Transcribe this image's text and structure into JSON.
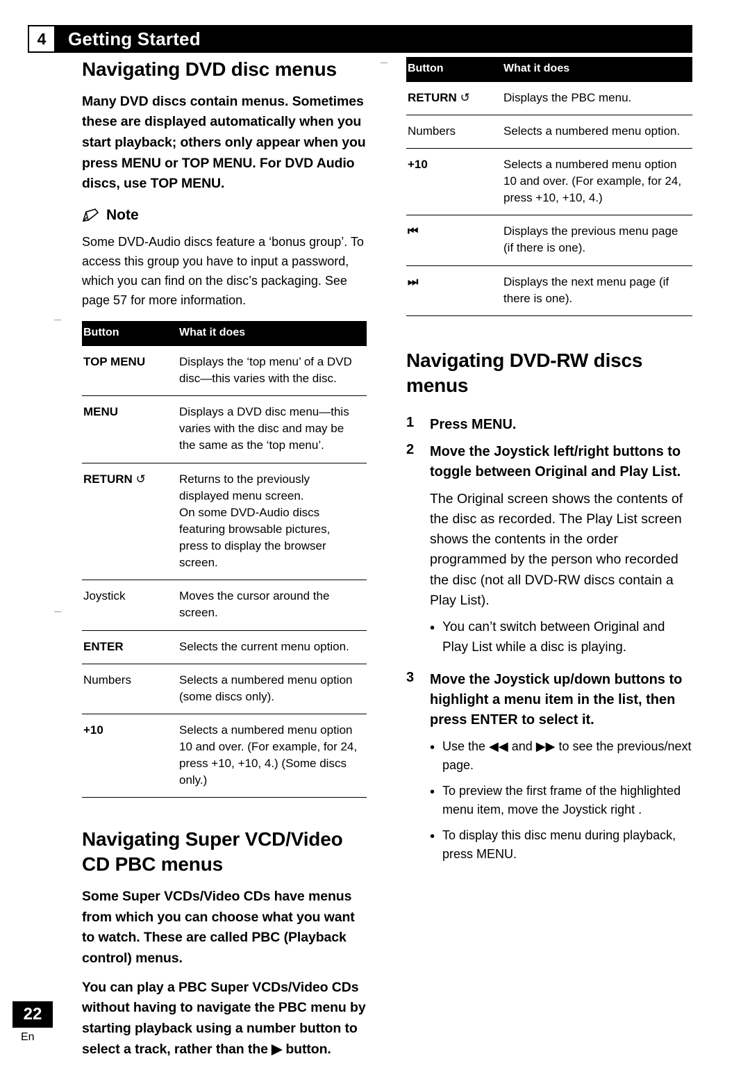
{
  "header": {
    "chapter_number": "4",
    "title": "Getting Started"
  },
  "page": {
    "number": "22",
    "language": "En"
  },
  "left": {
    "heading1": "Navigating DVD disc menus",
    "intro": "Many DVD discs contain menus. Sometimes these are displayed automatically when you start playback; others only appear when you press MENU or TOP MENU. For DVD Audio discs, use TOP MENU.",
    "note_label": "Note",
    "note_text": "Some DVD-Audio discs feature a ‘bonus group’. To access this group you have to input a password, which you can find on the disc’s packaging. See page 57 for more information.",
    "table": {
      "headers": [
        "Button",
        "What it does"
      ],
      "rows": [
        {
          "button": "TOP MENU",
          "bold": true,
          "what": "Displays the ‘top menu’ of a DVD disc—this varies with the disc."
        },
        {
          "button": "MENU",
          "bold": true,
          "what": "Displays a DVD disc menu—this varies with the disc and may be the same as the ‘top menu’."
        },
        {
          "button": "RETURN",
          "bold": true,
          "icon": "return-symbol",
          "what": "Returns to the previously displayed menu screen.\nOn some DVD-Audio discs featuring browsable pictures, press to display the browser screen."
        },
        {
          "button": "Joystick",
          "bold": false,
          "what": "Moves the cursor around the screen."
        },
        {
          "button": "ENTER",
          "bold": true,
          "what": "Selects the current menu option."
        },
        {
          "button": "Numbers",
          "bold": false,
          "what": "Selects a numbered menu option (some discs only)."
        },
        {
          "button": "+10",
          "bold": true,
          "what": "Selects a numbered menu option 10 and over. (For example, for 24, press +10, +10, 4.) (Some discs only.)"
        }
      ]
    },
    "heading2": "Navigating Super VCD/Video CD PBC menus",
    "para1": "Some Super VCDs/Video CDs have menus from which you can choose what you want to watch. These are called PBC (Playback control) menus.",
    "para2": "You can play a PBC Super VCDs/Video CDs without having to navigate the PBC menu by starting playback using a number button to select a track, rather than the ▶ button."
  },
  "right": {
    "table": {
      "headers": [
        "Button",
        "What it does"
      ],
      "rows": [
        {
          "button": "RETURN",
          "bold": true,
          "icon": "return-symbol",
          "what": "Displays the PBC menu."
        },
        {
          "button": "Numbers",
          "bold": false,
          "what": "Selects a numbered menu option."
        },
        {
          "button": "+10",
          "bold": true,
          "what": "Selects a numbered menu option 10 and over. (For example, for 24, press +10, +10, 4.)"
        },
        {
          "button": "◀◀",
          "bold": true,
          "icon": "prev-icon",
          "what": "Displays the previous menu page (if there is one)."
        },
        {
          "button": "▶▶",
          "bold": true,
          "icon": "next-icon",
          "what": "Displays the next menu page (if there is one)."
        }
      ]
    },
    "heading": "Navigating DVD-RW discs menus",
    "steps": [
      {
        "n": "1",
        "text": "Press MENU."
      },
      {
        "n": "2",
        "text": "Move the Joystick left/right buttons to toggle between Original and Play List."
      },
      {
        "n": "3",
        "text": "Move the Joystick up/down buttons to highlight a menu item in the list, then press ENTER to select it."
      }
    ],
    "step2_body": "The Original screen shows the contents of the disc as recorded. The Play List screen shows the contents in the order programmed by the person who recorded the disc (not all DVD-RW discs contain a Play List).",
    "step2_bullet": "You can’t switch between Original and Play List while a disc is playing.",
    "step3_bullets": [
      "Use the ◀◀ and ▶▶ to see the previous/next page.",
      "To preview the first frame of the highlighted menu item, move the Joystick right .",
      "To display this disc menu during playback, press MENU."
    ]
  }
}
